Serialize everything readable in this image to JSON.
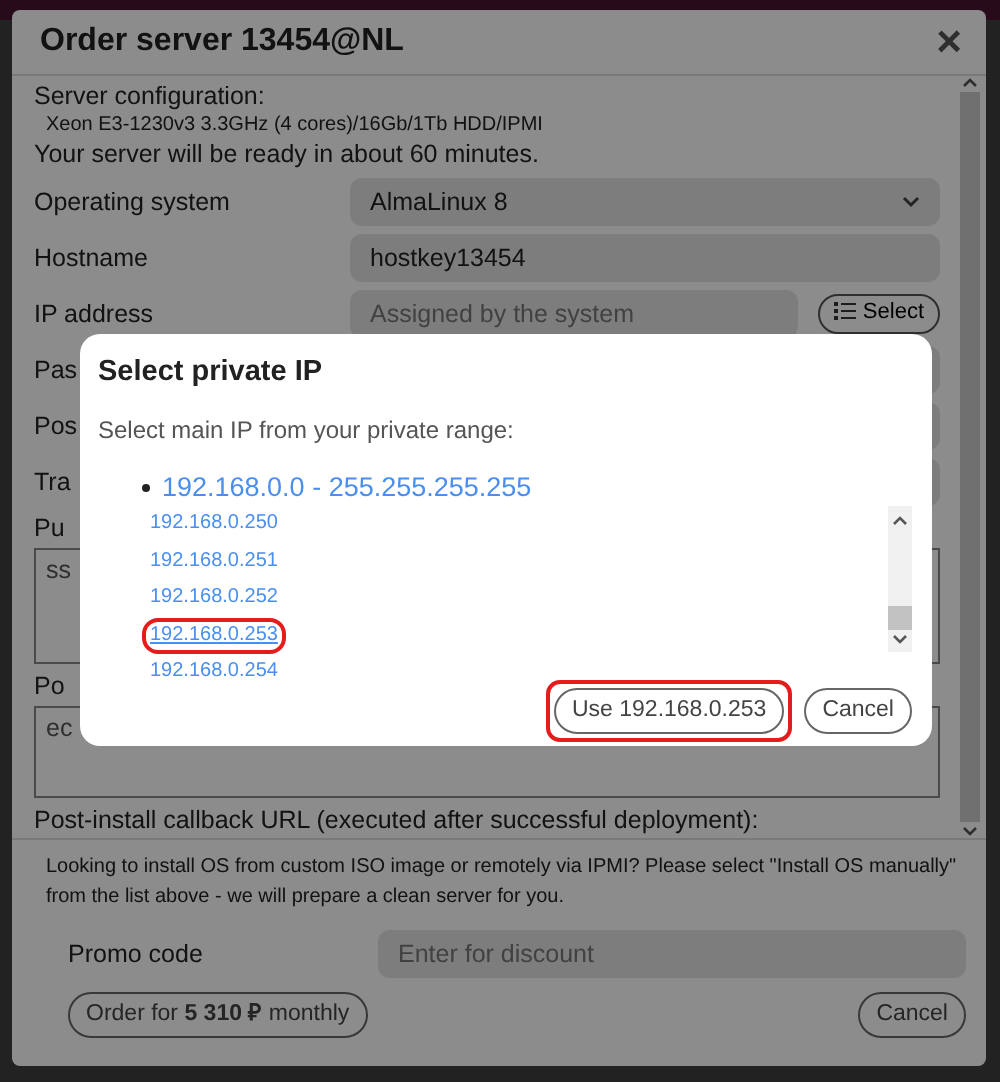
{
  "order_modal": {
    "title": "Order server 13454@NL",
    "close": "×",
    "config_label": "Server configuration:",
    "config_value": "Xeon E3-1230v3 3.3GHz (4 cores)/16Gb/1Tb HDD/IPMI",
    "ready_note": "Your server will be ready in about 60 minutes.",
    "fields": [
      {
        "kind": "select",
        "label": "Operating system",
        "value": "AlmaLinux 8"
      },
      {
        "kind": "input",
        "label": "Hostname",
        "value": "hostkey13454"
      },
      {
        "kind": "input-button",
        "label": "IP address",
        "placeholder": "Assigned by the system",
        "button": "Select"
      },
      {
        "kind": "input",
        "label": "Pas"
      },
      {
        "kind": "input",
        "label": "Pos"
      },
      {
        "kind": "input",
        "label": "Tra"
      },
      {
        "kind": "textarea",
        "label": "Pu",
        "value": "ss"
      },
      {
        "kind": "textarea",
        "label": "Po",
        "value": "ec"
      },
      {
        "kind": "label",
        "label": "Post-install callback URL (executed after successful deployment):"
      }
    ],
    "info": "Looking to install OS from custom ISO image or remotely via IPMI? Please select \"Install OS manually\" from the list above - we will prepare a clean server for you.",
    "promo": {
      "label": "Promo code",
      "placeholder": "Enter for discount"
    },
    "order_button": "Order for **5 310 ₽** monthly",
    "cancel_button": "Cancel"
  },
  "ip_dialog": {
    "title": "Select private IP",
    "prompt": "Select main IP from your private range:",
    "range": {
      "label": "192.168.0.0 - 255.255.255.255",
      "children": [
        {
          "label": "192.168.0.250",
          "highlighted": false
        },
        {
          "label": "192.168.0.251",
          "highlighted": false
        },
        {
          "label": "192.168.0.252",
          "highlighted": false
        },
        {
          "label": "192.168.0.253",
          "highlighted": true
        },
        {
          "label": "192.168.0.254",
          "highlighted": false
        }
      ]
    },
    "use_button": {
      "label": "Use 192.168.0.253",
      "highlighted": true
    },
    "cancel_button": "Cancel"
  }
}
